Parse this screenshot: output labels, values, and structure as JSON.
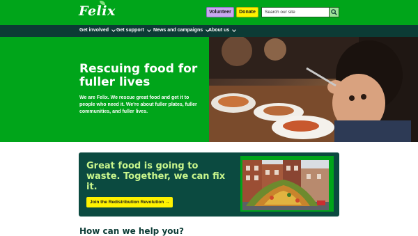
{
  "header": {
    "logo_text": "Felix",
    "volunteer_label": "Volunteer",
    "donate_label": "Donate",
    "search_placeholder": "Search our site"
  },
  "nav": {
    "items": [
      {
        "label": "Get involved"
      },
      {
        "label": "Get support"
      },
      {
        "label": "News and campaigns"
      },
      {
        "label": "About us"
      }
    ]
  },
  "hero": {
    "title": "Rescuing food for fuller lives",
    "body": "We are Felix. We rescue great food and get it to people who need it. We're about fuller plates, fuller communities, and fuller lives."
  },
  "promo": {
    "title": "Great food is going to waste. Together, we can fix it.",
    "button_label": "Join the Redistribution Revolution →"
  },
  "help": {
    "heading": "How can we help you?"
  },
  "colors": {
    "brand_green": "#00a51a",
    "dark_teal": "#0c3b35",
    "promo_teal": "#0b4a40",
    "accent_yellow": "#fff200",
    "accent_lilac": "#c9a8f0",
    "promo_text_green": "#c8f58c"
  },
  "icons": {
    "search": "search-icon",
    "chevron": "chevron-down-icon"
  }
}
